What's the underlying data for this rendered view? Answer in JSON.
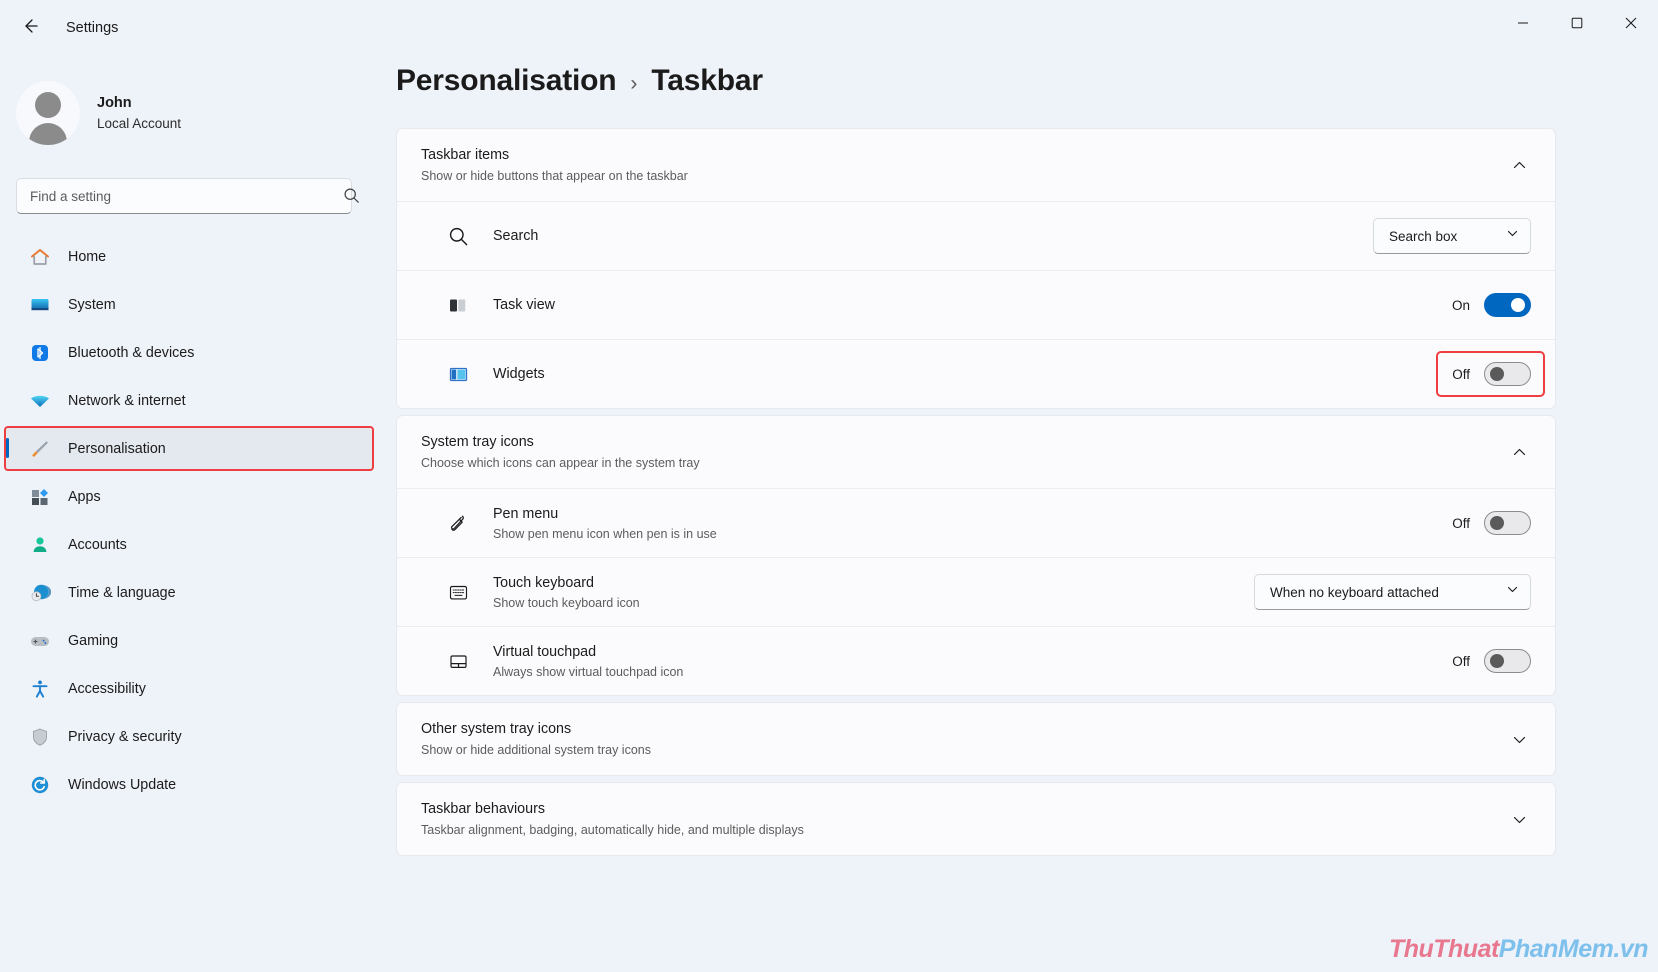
{
  "titlebar": {
    "title": "Settings",
    "back_icon": "arrow-left-icon",
    "minimize_icon": "minimize-icon",
    "maximize_icon": "maximize-icon",
    "close_icon": "close-icon"
  },
  "account": {
    "name": "John",
    "subtitle": "Local Account",
    "avatar_icon": "avatar-icon"
  },
  "search": {
    "placeholder": "Find a setting",
    "value": "",
    "icon": "search-icon"
  },
  "sidebar": {
    "items": [
      {
        "label": "Home",
        "icon": "home-icon",
        "active": false
      },
      {
        "label": "System",
        "icon": "system-icon",
        "active": false
      },
      {
        "label": "Bluetooth & devices",
        "icon": "bluetooth-icon",
        "active": false
      },
      {
        "label": "Network & internet",
        "icon": "wifi-icon",
        "active": false
      },
      {
        "label": "Personalisation",
        "icon": "paintbrush-icon",
        "active": true
      },
      {
        "label": "Apps",
        "icon": "apps-icon",
        "active": false
      },
      {
        "label": "Accounts",
        "icon": "accounts-icon",
        "active": false
      },
      {
        "label": "Time & language",
        "icon": "clock-globe-icon",
        "active": false
      },
      {
        "label": "Gaming",
        "icon": "gamepad-icon",
        "active": false
      },
      {
        "label": "Accessibility",
        "icon": "accessibility-icon",
        "active": false
      },
      {
        "label": "Privacy & security",
        "icon": "shield-icon",
        "active": false
      },
      {
        "label": "Windows Update",
        "icon": "update-icon",
        "active": false
      }
    ]
  },
  "breadcrumb": {
    "parent": "Personalisation",
    "separator": "›",
    "current": "Taskbar"
  },
  "sections": {
    "taskbar_items": {
      "title": "Taskbar items",
      "subtitle": "Show or hide buttons that appear on the taskbar",
      "chevron": "chevron-up-icon",
      "rows": [
        {
          "title": "Search",
          "icon": "search-icon",
          "control": "dropdown",
          "value": "Search box",
          "chevron": "chevron-down-icon"
        },
        {
          "title": "Task view",
          "icon": "task-view-icon",
          "control": "toggle",
          "state_label": "On",
          "state": "on"
        },
        {
          "title": "Widgets",
          "icon": "widgets-icon",
          "control": "toggle",
          "state_label": "Off",
          "state": "off",
          "highlighted": true
        }
      ]
    },
    "system_tray_icons": {
      "title": "System tray icons",
      "subtitle": "Choose which icons can appear in the system tray",
      "chevron": "chevron-up-icon",
      "rows": [
        {
          "title": "Pen menu",
          "subtitle": "Show pen menu icon when pen is in use",
          "icon": "pen-icon",
          "control": "toggle",
          "state_label": "Off",
          "state": "off"
        },
        {
          "title": "Touch keyboard",
          "subtitle": "Show touch keyboard icon",
          "icon": "keyboard-icon",
          "control": "dropdown",
          "value": "When no keyboard attached",
          "chevron": "chevron-down-icon"
        },
        {
          "title": "Virtual touchpad",
          "subtitle": "Always show virtual touchpad icon",
          "icon": "touchpad-icon",
          "control": "toggle",
          "state_label": "Off",
          "state": "off"
        }
      ]
    },
    "other_system_tray_icons": {
      "title": "Other system tray icons",
      "subtitle": "Show or hide additional system tray icons",
      "chevron": "chevron-down-icon"
    },
    "taskbar_behaviours": {
      "title": "Taskbar behaviours",
      "subtitle": "Taskbar alignment, badging, automatically hide, and multiple displays",
      "chevron": "chevron-down-icon"
    }
  },
  "watermark": {
    "part1": "ThuThuat",
    "part2": "PhanMem.vn"
  },
  "colors": {
    "accent": "#0067c0",
    "highlight": "#ef3e42",
    "page_bg": "#eef2f9",
    "card_bg": "#fbfbfd"
  }
}
